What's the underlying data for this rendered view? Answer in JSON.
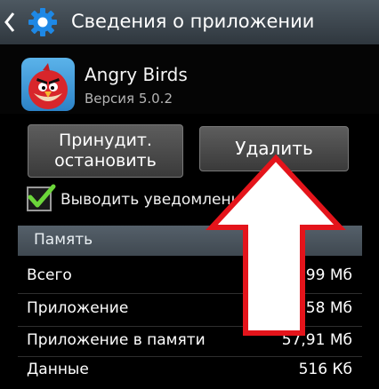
{
  "header": {
    "title": "Сведения о приложении"
  },
  "app": {
    "name": "Angry Birds",
    "version": "Версия 5.0.2"
  },
  "buttons": {
    "force_stop_line1": "Принудит.",
    "force_stop_line2": "остановить",
    "delete": "Удалить"
  },
  "notifications": {
    "label": "Выводить уведомления",
    "checked": true
  },
  "memory": {
    "title": "Память",
    "rows": [
      {
        "label": "Всего",
        "value": ",99 Мб"
      },
      {
        "label": "Приложение",
        "value": ",58 Мб"
      },
      {
        "label": "Приложение в памяти",
        "value": "57,91 Мб"
      },
      {
        "label": "Данные",
        "value": "516 Кб"
      }
    ]
  },
  "colors": {
    "arrow": "#e4141b",
    "checkmark": "#6cd63a",
    "header_bg": "#46515a"
  },
  "icons": [
    "back-chevron-icon",
    "settings-gear-icon",
    "angry-birds-app-icon",
    "checkmark-icon",
    "red-arrow-annotation"
  ]
}
